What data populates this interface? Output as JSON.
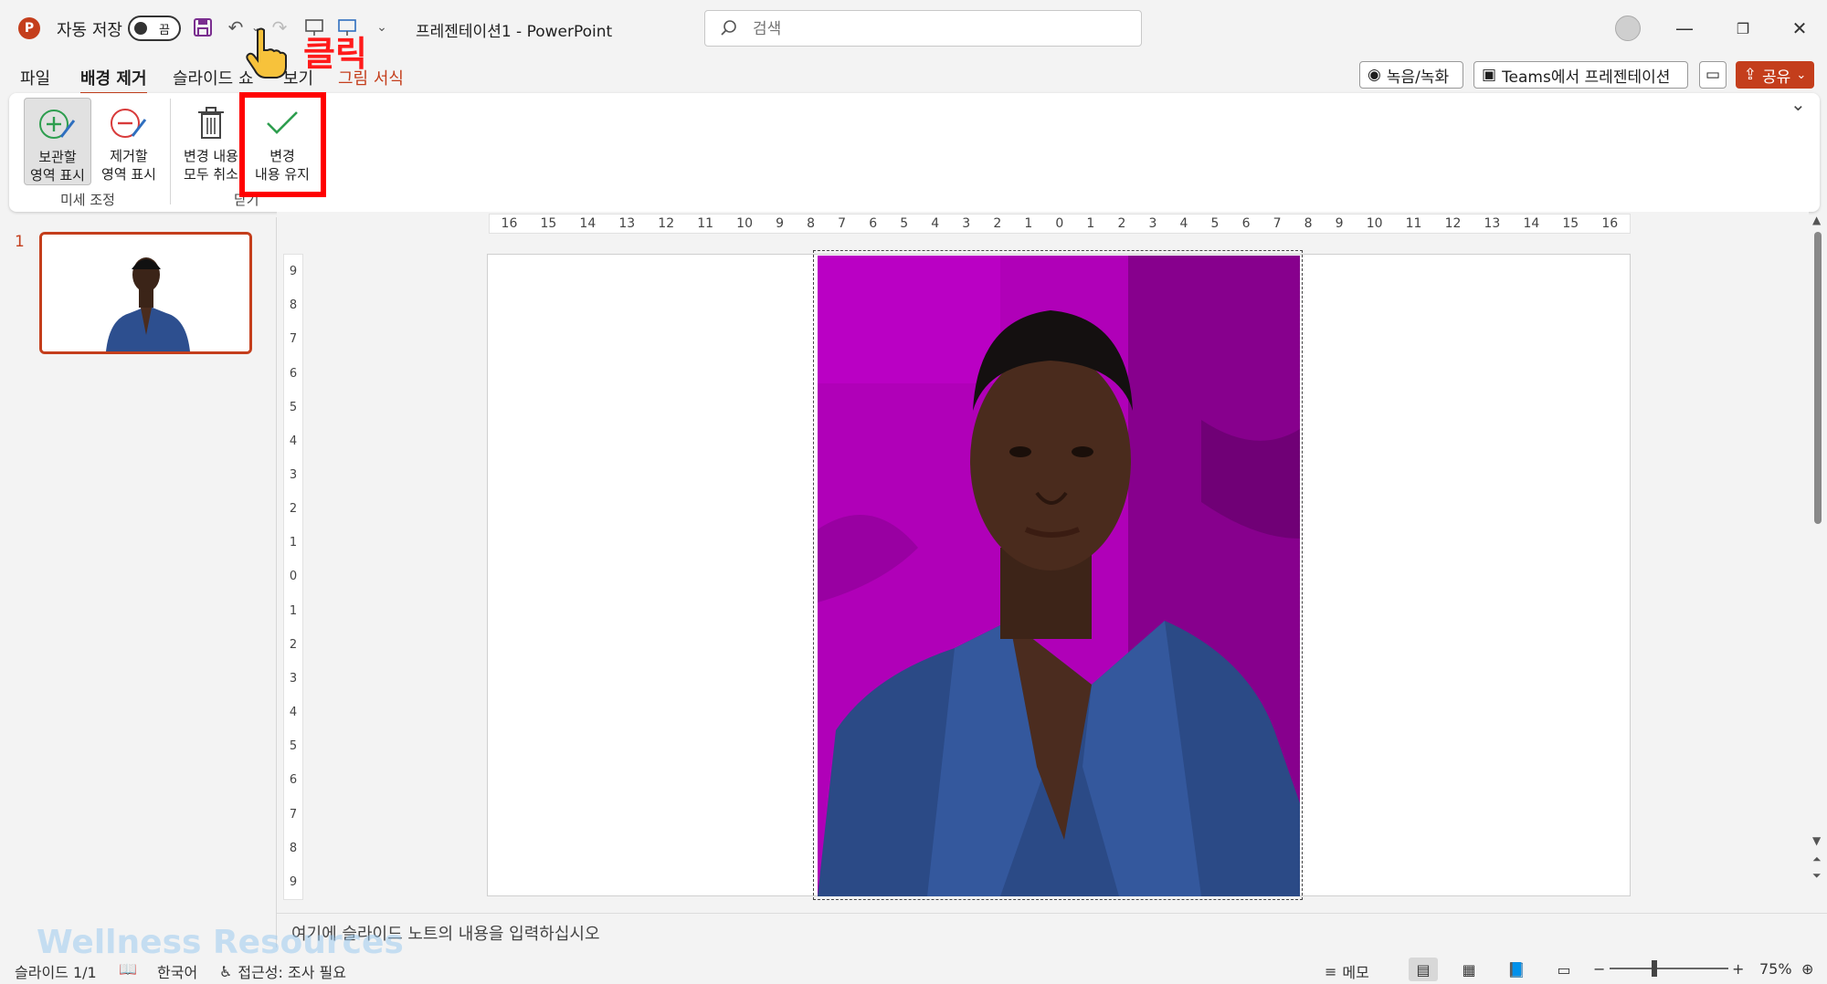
{
  "titlebar": {
    "autosave_label": "자동 저장",
    "autosave_state": "끔",
    "document_title": "프레젠테이션1  -  PowerPoint",
    "search_placeholder": "검색"
  },
  "tabs": {
    "file": "파일",
    "background_removal": "배경 제거",
    "slideshow": "슬라이드 쇼",
    "view": "보기",
    "picture_format": "그림 서식"
  },
  "header_buttons": {
    "record": "녹음/녹화",
    "teams": "Teams에서 프레젠테이션",
    "share": "공유"
  },
  "ribbon": {
    "mark_keep": "보관할\n영역 표시",
    "mark_remove": "제거할\n영역 표시",
    "discard_all": "변경 내용\n모두 취소",
    "keep_changes": "변경\n내용 유지",
    "group_refine": "미세 조정",
    "group_close": "닫기"
  },
  "annotation": {
    "text": "클릭",
    "color": "#ff0000"
  },
  "thumbnails": {
    "slide_number": "1"
  },
  "rulers": {
    "horizontal": [
      "16",
      "15",
      "14",
      "13",
      "12",
      "11",
      "10",
      "9",
      "8",
      "7",
      "6",
      "5",
      "4",
      "3",
      "2",
      "1",
      "0",
      "1",
      "2",
      "3",
      "4",
      "5",
      "6",
      "7",
      "8",
      "9",
      "10",
      "11",
      "12",
      "13",
      "14",
      "15",
      "16"
    ],
    "vertical": [
      "9",
      "8",
      "7",
      "6",
      "5",
      "4",
      "3",
      "2",
      "1",
      "0",
      "1",
      "2",
      "3",
      "4",
      "5",
      "6",
      "7",
      "8",
      "9"
    ]
  },
  "notes": {
    "placeholder": "여기에 슬라이드 노트의 내용을 입력하십시오"
  },
  "watermark": "Wellness Resources",
  "statusbar": {
    "slide_count": "슬라이드 1/1",
    "language": "한국어",
    "accessibility": "접근성: 조사 필요",
    "notes": "메모",
    "zoom": "75%"
  },
  "colors": {
    "accent": "#c43e1c",
    "removal_mask": "#b000b8"
  }
}
